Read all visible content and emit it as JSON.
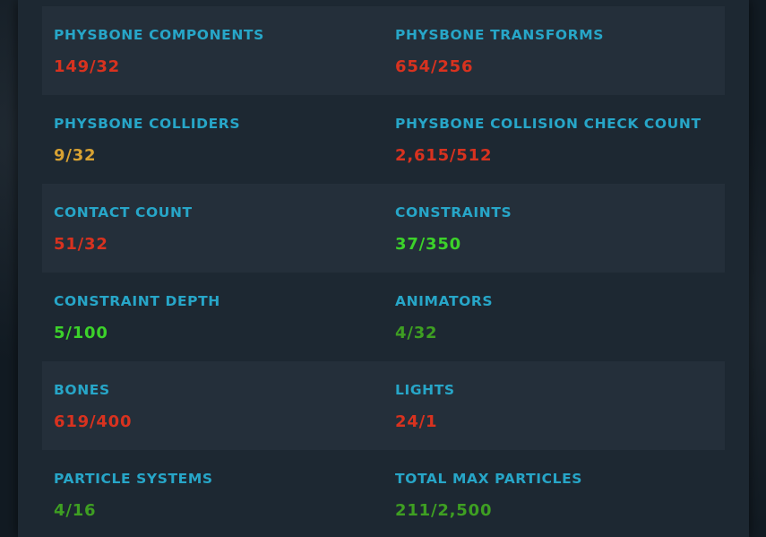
{
  "stats": [
    {
      "label": "PHYSBONE COMPONENTS",
      "value": "149/32",
      "status": "red"
    },
    {
      "label": "PHYSBONE TRANSFORMS",
      "value": "654/256",
      "status": "red"
    },
    {
      "label": "PHYSBONE COLLIDERS",
      "value": "9/32",
      "status": "yellow"
    },
    {
      "label": "PHYSBONE COLLISION CHECK COUNT",
      "value": "2,615/512",
      "status": "red"
    },
    {
      "label": "CONTACT COUNT",
      "value": "51/32",
      "status": "red"
    },
    {
      "label": "CONSTRAINTS",
      "value": "37/350",
      "status": "green"
    },
    {
      "label": "CONSTRAINT DEPTH",
      "value": "5/100",
      "status": "green"
    },
    {
      "label": "ANIMATORS",
      "value": "4/32",
      "status": "dkgreen"
    },
    {
      "label": "BONES",
      "value": "619/400",
      "status": "red"
    },
    {
      "label": "LIGHTS",
      "value": "24/1",
      "status": "red"
    },
    {
      "label": "PARTICLE SYSTEMS",
      "value": "4/16",
      "status": "dkgreen"
    },
    {
      "label": "TOTAL MAX PARTICLES",
      "value": "211/2,500",
      "status": "dkgreen"
    }
  ],
  "colors": {
    "label": "#27a6c8",
    "red": "#d8321f",
    "yellow": "#d8a232",
    "green": "#3cd22a",
    "dkgreen": "#3e9f22",
    "panel": "#1d2832",
    "row_shaded": "#242f3a"
  }
}
